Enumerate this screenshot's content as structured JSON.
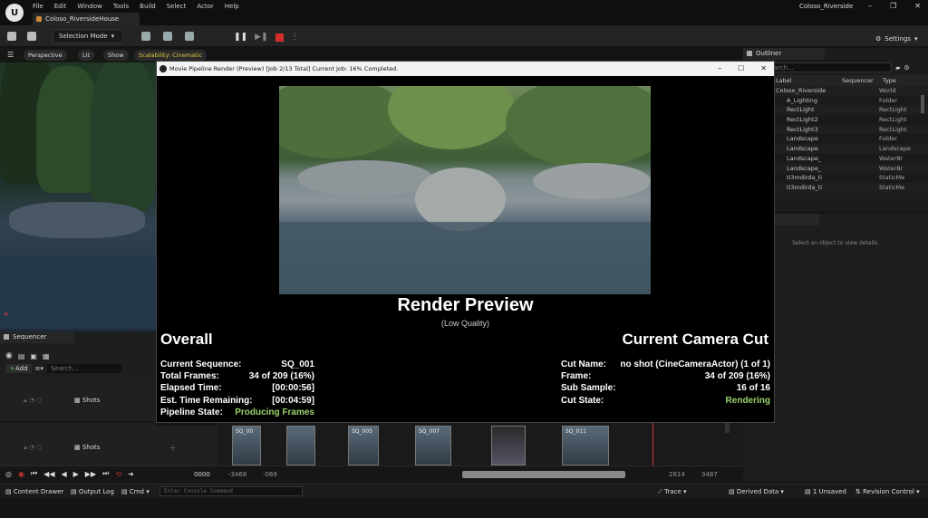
{
  "menubar": {
    "items": [
      "File",
      "Edit",
      "Window",
      "Tools",
      "Build",
      "Select",
      "Actor",
      "Help"
    ],
    "doc_tab": "Coloso_RiversideHouse",
    "project": "Coloso_Riverside"
  },
  "toolbar": {
    "mode": "Selection Mode",
    "settings": "Settings"
  },
  "viewport": {
    "perspective": "Perspective",
    "lit": "Lit",
    "show": "Show",
    "scalability": "Scalability: Cinematic"
  },
  "dialog": {
    "title": "Movie Pipeline Render (Preview) [Job 2/13 Total] Current Job: 16% Completed.",
    "preview_title": "Render Preview",
    "preview_subtitle": "(Low Quality)",
    "overall": {
      "heading": "Overall",
      "rows": [
        {
          "k": "Current Sequence:",
          "v": "SQ_001"
        },
        {
          "k": "Total Frames:",
          "v": "34 of 209 (16%)"
        },
        {
          "k": "Elapsed Time:",
          "v": "[00:00:56]"
        },
        {
          "k": "Est. Time Remaining:",
          "v": "[00:04:59]"
        },
        {
          "k": "Pipeline State:",
          "v": "Producing Frames"
        }
      ]
    },
    "camera_cut": {
      "heading": "Current Camera Cut",
      "rows": [
        {
          "k": "Cut Name:",
          "v": "no shot (CineCameraActor) (1 of 1)"
        },
        {
          "k": "Frame:",
          "v": "34 of 209 (16%)"
        },
        {
          "k": "Sub Sample:",
          "v": "16 of 16"
        },
        {
          "k": "Cut State:",
          "v": "Rendering"
        }
      ]
    }
  },
  "outliner": {
    "tab": "Outliner",
    "search_placeholder": "Search...",
    "col_label": "Label",
    "col_sequencer": "Sequencer",
    "col_type": "Type",
    "rows": [
      {
        "label": "Coloso_Riverside",
        "type": "World"
      },
      {
        "label": "A_Lighting",
        "type": "Folder"
      },
      {
        "label": "RectLight",
        "type": "RectLight"
      },
      {
        "label": "RectLight2",
        "type": "RectLight"
      },
      {
        "label": "RectLight3",
        "type": "RectLight"
      },
      {
        "label": "Landscape",
        "type": "Folder"
      },
      {
        "label": "Landscape",
        "type": "Landscape"
      },
      {
        "label": "Landscape_",
        "type": "WaterBr"
      },
      {
        "label": "Landscape_",
        "type": "WaterBr"
      },
      {
        "label": "ti3mdirda_ti",
        "type": "StaticMe"
      },
      {
        "label": "ti3mdirda_ti",
        "type": "StaticMe"
      }
    ],
    "details_hint": "Select an object to view details."
  },
  "sequencer": {
    "tab": "Sequencer",
    "add": "Add",
    "search_placeholder": "Search...",
    "tracks": [
      "Shots",
      "Shots"
    ],
    "shots": [
      "SQ_00",
      "SQ_005",
      "SQ_007",
      "SQ_011"
    ],
    "frame": "0000",
    "range_start": "-3468",
    "range_mid": "-069",
    "range_end1": "2814",
    "range_end2": "3487"
  },
  "statusbar": {
    "content_drawer": "Content Drawer",
    "output_log": "Output Log",
    "cmd": "Cmd",
    "console_placeholder": "Enter Console Command",
    "trace": "Trace",
    "derived_data": "Derived Data",
    "unsaved": "1 Unsaved",
    "revision": "Revision Control"
  }
}
